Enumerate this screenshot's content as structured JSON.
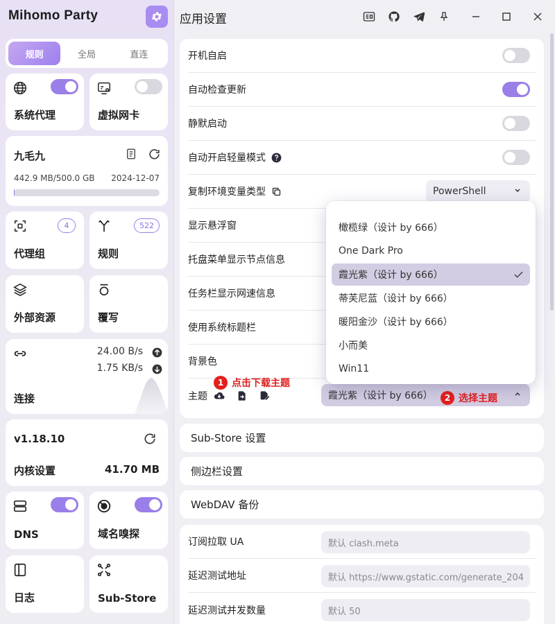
{
  "app": {
    "title": "Mihomo Party"
  },
  "sidebar": {
    "modes": [
      "规则",
      "全局",
      "直连"
    ],
    "system_proxy": {
      "label": "系统代理",
      "enabled": true
    },
    "tun": {
      "label": "虚拟网卡",
      "enabled": false
    },
    "profile": {
      "name": "九毛九",
      "usage": "442.9 MB/500.0 GB",
      "expire": "2024-12-07",
      "usage_fraction": 0.0009
    },
    "proxy_groups": {
      "label": "代理组",
      "count": "4"
    },
    "rules": {
      "label": "规则",
      "count": "522"
    },
    "resources": {
      "label": "外部资源"
    },
    "override": {
      "label": "覆写"
    },
    "connections": {
      "label": "连接",
      "upload": "24.00 B/s",
      "download": "1.75 KB/s"
    },
    "core": {
      "version": "v1.18.10",
      "label": "内核设置",
      "memory": "41.70 MB"
    },
    "dns": {
      "label": "DNS",
      "enabled": true
    },
    "sniff": {
      "label": "域名嗅探",
      "enabled": true
    },
    "logs": {
      "label": "日志"
    },
    "substore": {
      "label": "Sub-Store"
    }
  },
  "main": {
    "title": "应用设置",
    "settings": [
      {
        "label": "开机自启",
        "value": false
      },
      {
        "label": "自动检查更新",
        "value": true
      },
      {
        "label": "静默启动",
        "value": false
      },
      {
        "label": "自动开启轻量模式",
        "value": false
      }
    ],
    "env_type": {
      "label": "复制环境变量类型",
      "value": "PowerShell"
    },
    "show_float": {
      "label": "显示悬浮窗"
    },
    "tray_node": {
      "label": "托盘菜单显示节点信息"
    },
    "taskbar_speed": {
      "label": "任务栏显示网速信息"
    },
    "sys_titlebar": {
      "label": "使用系统标题栏"
    },
    "bg_color": {
      "label": "背景色"
    },
    "theme": {
      "label": "主题",
      "value": "霞光紫（设计 by 666）"
    },
    "theme_options": [
      "橄榄绿（设计 by 666）",
      "One Dark Pro",
      "霞光紫（设计 by 666）",
      "蒂芙尼蓝（设计 by 666）",
      "暖阳金沙（设计 by 666）",
      "小而美",
      "Win11"
    ],
    "selected_theme_index": 2,
    "annotation_1": {
      "num": "1",
      "text": "点击下载主题"
    },
    "annotation_2": {
      "num": "2",
      "text": "选择主题"
    },
    "sections": [
      "Sub-Store 设置",
      "侧边栏设置",
      "WebDAV 备份"
    ],
    "network": [
      {
        "label": "订阅拉取 UA",
        "placeholder": "默认 clash.meta"
      },
      {
        "label": "延迟测试地址",
        "placeholder": "默认 https://www.gstatic.com/generate_204"
      },
      {
        "label": "延迟测试并发数量",
        "placeholder": "默认 50"
      }
    ]
  },
  "colors": {
    "accent": "#9a7fe8",
    "annotation": "#e3201c"
  }
}
